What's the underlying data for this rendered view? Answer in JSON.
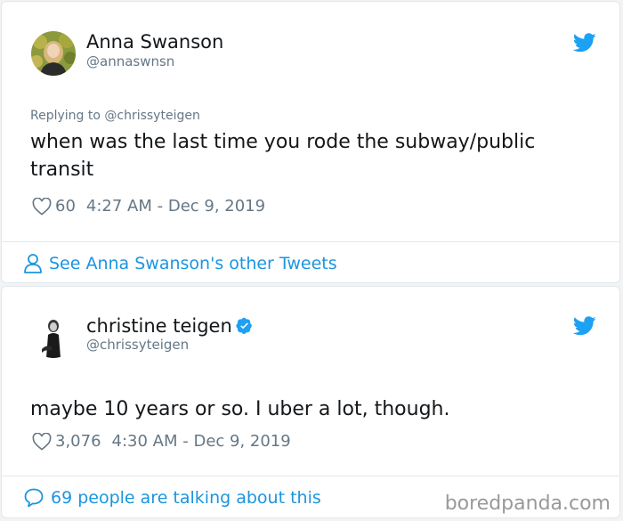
{
  "tweet1": {
    "display_name": "Anna Swanson",
    "handle": "@annaswnsn",
    "replying_to": "Replying to @chrissyteigen",
    "text": "when was the last time you rode the subway/public transit",
    "likes": "60",
    "timestamp": "4:27 AM - Dec 9, 2019",
    "footer_link": "See Anna Swanson's other Tweets",
    "icons": [
      "avatar",
      "twitter-bird-icon",
      "heart-icon",
      "person-icon"
    ]
  },
  "tweet2": {
    "display_name": "christine teigen",
    "handle": "@chrissyteigen",
    "verified": true,
    "text": "maybe 10 years or so. I uber a lot, though.",
    "likes": "3,076",
    "timestamp": "4:30 AM - Dec 9, 2019",
    "footer_link": "69 people are talking about this",
    "icons": [
      "avatar",
      "verified-badge-icon",
      "twitter-bird-icon",
      "heart-icon",
      "speech-bubble-icon"
    ]
  },
  "watermark": "boredpanda.com",
  "colors": {
    "twitter_blue": "#1da1f2",
    "link_blue": "#1b95e0",
    "secondary_text": "#657786",
    "primary_text": "#14171a"
  }
}
